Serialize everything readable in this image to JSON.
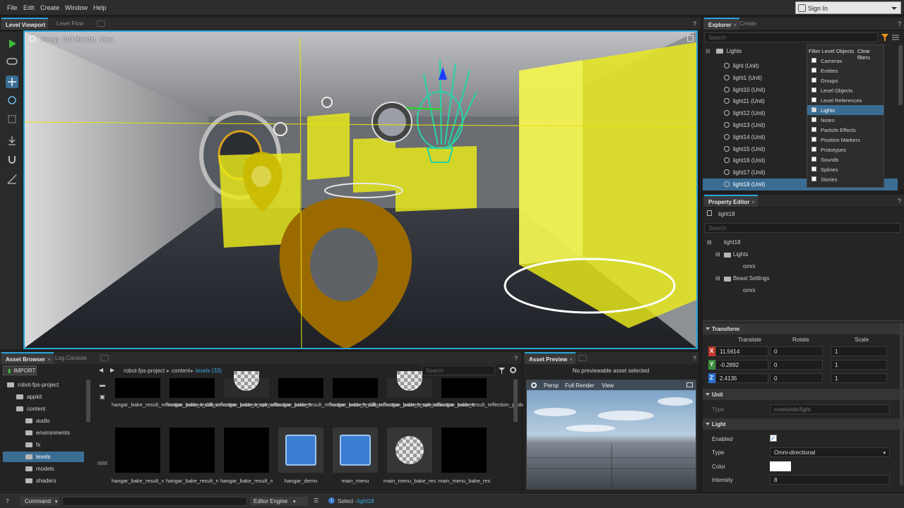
{
  "menu": {
    "items": [
      "File",
      "Edit",
      "Create",
      "Window",
      "Help"
    ],
    "sign_in": "Sign In"
  },
  "viewport": {
    "tabs": [
      "Level Viewport",
      "Level Flow"
    ],
    "help": "?",
    "toolbar": {
      "persp": "Persp",
      "render": "Full Render",
      "view": "View"
    }
  },
  "explorer": {
    "tabs": [
      "Explorer",
      "Create"
    ],
    "help": "?",
    "search_placeholder": "Search",
    "root": "Lights",
    "items": [
      "light (Unit)",
      "light1 (Unit)",
      "light10 (Unit)",
      "light11 (Unit)",
      "light12 (Unit)",
      "light13 (Unit)",
      "light14 (Unit)",
      "light15 (Unit)",
      "light16 (Unit)",
      "light17 (Unit)",
      "light18 (Unit)"
    ],
    "selected": "light18 (Unit)",
    "filter": {
      "title": "Filter Level Objects",
      "clear": "Clear filters",
      "options": [
        "Cameras",
        "Entities",
        "Groups",
        "Level Objects",
        "Level References",
        "Lights",
        "Notes",
        "Particle Effects",
        "Position Markers",
        "Prototypes",
        "Sounds",
        "Splines",
        "Stories"
      ],
      "checked": "Lights"
    }
  },
  "property_editor": {
    "tab": "Property Editor",
    "help": "?",
    "object": "light18",
    "search_placeholder": "Search",
    "tree": {
      "root": "light18",
      "lights": "Lights",
      "omni1": "omni",
      "beast": "Beast Settings",
      "omni2": "omni"
    },
    "transform": {
      "title": "Transform",
      "cols": [
        "Translate",
        "Rotate",
        "Scale"
      ],
      "rows": [
        {
          "axis": "X",
          "t": "11.5614",
          "r": "0",
          "s": "1"
        },
        {
          "axis": "Y",
          "t": "-0.2892",
          "r": "0",
          "s": "1"
        },
        {
          "axis": "Z",
          "t": "2.4135",
          "r": "0",
          "s": "1"
        }
      ]
    },
    "unit": {
      "title": "Unit",
      "type_label": "Type",
      "type_value": "core/units/light"
    },
    "light": {
      "title": "Light",
      "enabled_label": "Enabled",
      "type_label": "Type",
      "type_value": "Omni-directional",
      "color_label": "Color",
      "intensity_label": "Intensity",
      "intensity_value": "8"
    }
  },
  "asset_browser": {
    "tabs": [
      "Asset Browser",
      "Log Console"
    ],
    "help": "?",
    "import": "IMPORT",
    "breadcrumb": [
      "robot-fps-project",
      "content",
      "levels (33)"
    ],
    "search_placeholder": "Search",
    "tree": [
      "robot-fps-project",
      "appkit",
      "content",
      "audio",
      "environments",
      "fx",
      "levels",
      "models",
      "shaders"
    ],
    "assets_row1": [
      "hangar_bake_result_reflection_probe4_diffuse",
      "hangar_bake_result_reflection_probe4_specular",
      "hangar_bake_result_reflection_probe5",
      "hangar_bake_result_reflection_probe5_diffuse",
      "hangar_bake_result_reflection_probe5_specular",
      "hangar_bake_result_reflection_probe6",
      "hangar_bake_result_reflection_probe6_diffuse"
    ],
    "assets_row2": [
      "hangar_bake_result_reflection_probe",
      "hangar_bake_result_reflection_prob",
      "hangar_bake_result_reflection_probe_s",
      "hangar_demo",
      "main_menu",
      "main_menu_bake_result_reflection_pro",
      "main_menu_bake_result_reflection_pro"
    ]
  },
  "asset_preview": {
    "tab": "Asset Preview",
    "help": "?",
    "message": "No previewable asset selected",
    "toolbar": {
      "persp": "Persp",
      "render": "Full Render",
      "view": "View"
    }
  },
  "status": {
    "command": "Command",
    "engine": "Editor Engine",
    "select_label": "Select -",
    "select_value": "light18",
    "help": "?"
  },
  "colors": {
    "accent": "#28a4d8",
    "selection": "#3b6d93",
    "yellow": "#ecec1a",
    "orange_marker": "#9a6a00"
  }
}
